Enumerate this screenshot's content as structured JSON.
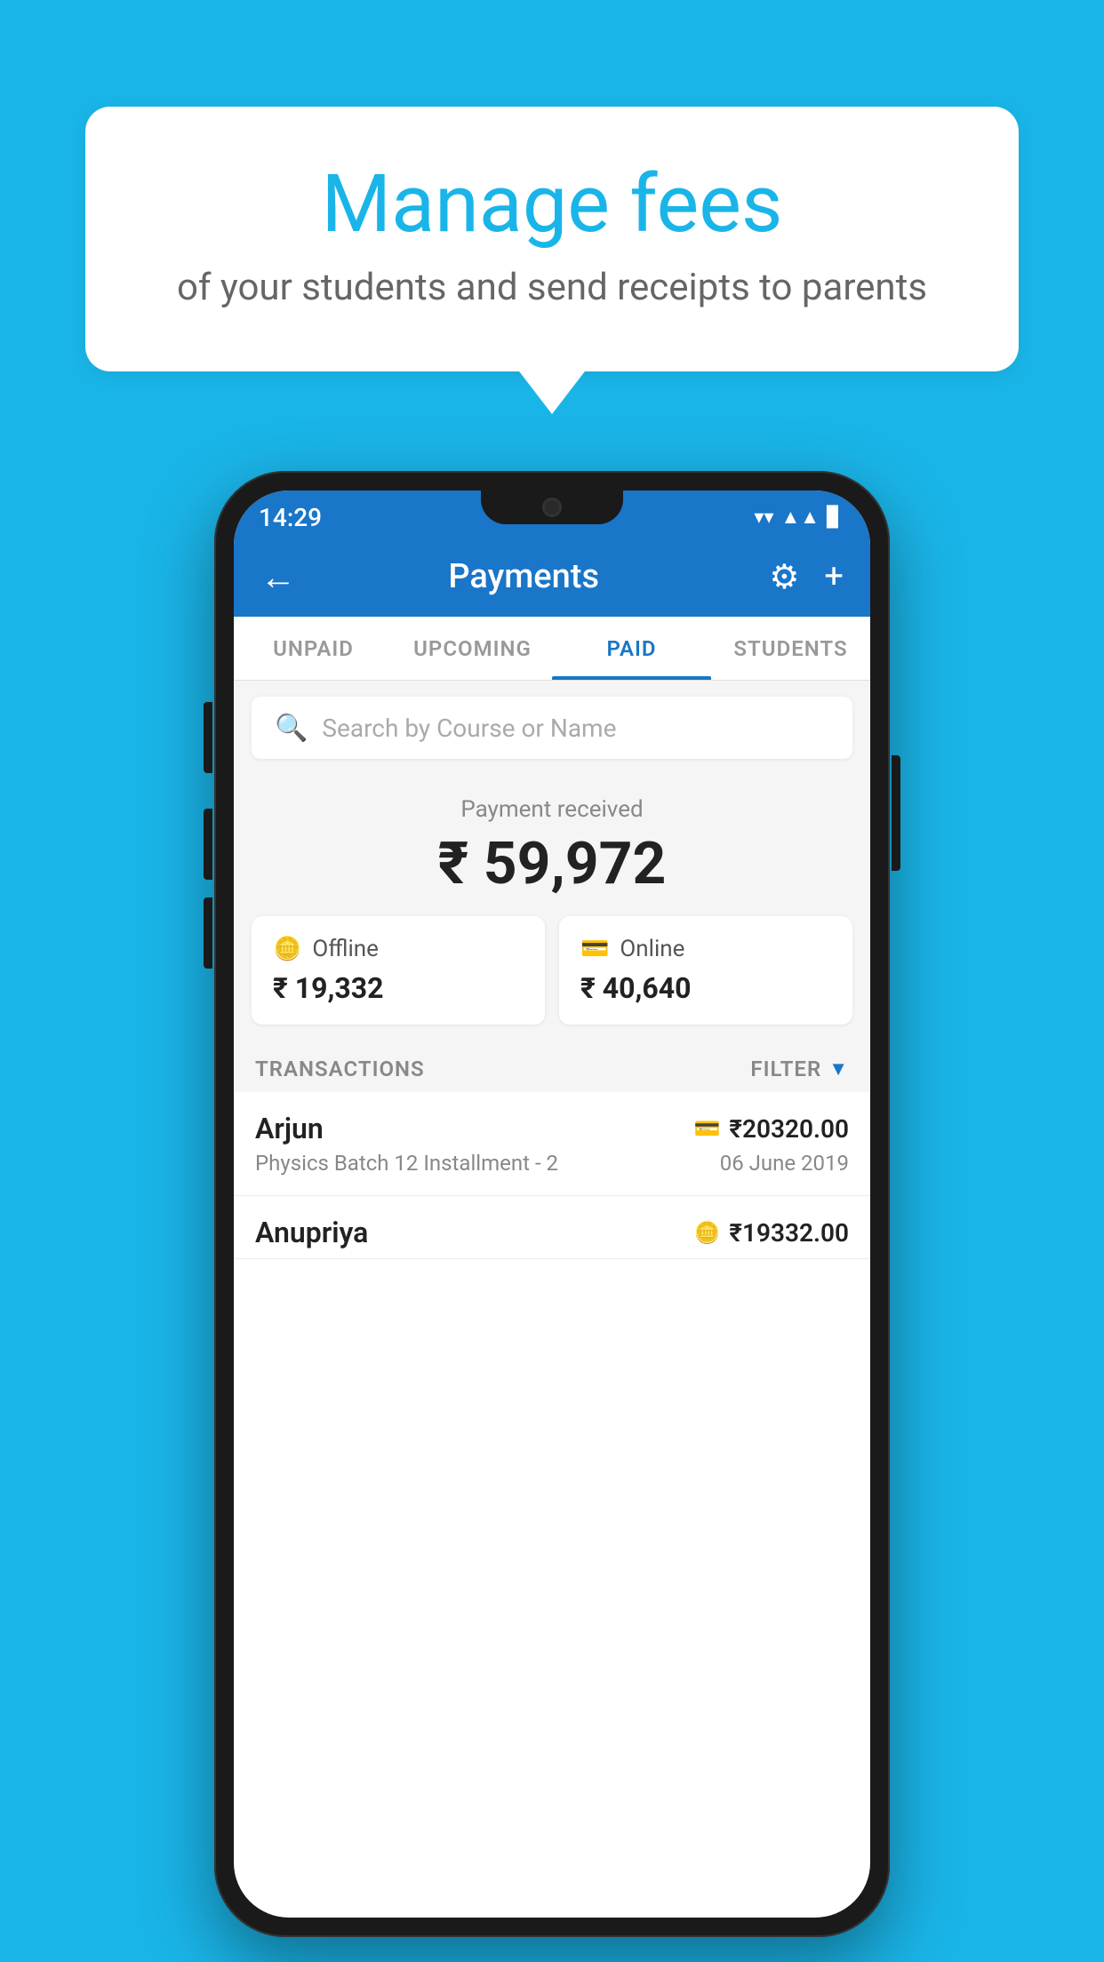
{
  "background_color": "#1ab5e8",
  "hero": {
    "title": "Manage fees",
    "subtitle": "of your students and send receipts to parents"
  },
  "status_bar": {
    "time": "14:29",
    "wifi": "▲",
    "signal": "▲",
    "battery": "▊"
  },
  "app_bar": {
    "title": "Payments",
    "back_icon": "←",
    "gear_icon": "⚙",
    "plus_icon": "+"
  },
  "tabs": [
    {
      "label": "UNPAID",
      "active": false
    },
    {
      "label": "UPCOMING",
      "active": false
    },
    {
      "label": "PAID",
      "active": true
    },
    {
      "label": "STUDENTS",
      "active": false
    }
  ],
  "search": {
    "placeholder": "Search by Course or Name"
  },
  "payment_received": {
    "label": "Payment received",
    "amount": "₹ 59,972",
    "offline": {
      "label": "Offline",
      "amount": "₹ 19,332"
    },
    "online": {
      "label": "Online",
      "amount": "₹ 40,640"
    }
  },
  "transactions_section": {
    "label": "TRANSACTIONS",
    "filter_label": "FILTER"
  },
  "transactions": [
    {
      "name": "Arjun",
      "amount": "₹20320.00",
      "course": "Physics Batch 12 Installment - 2",
      "date": "06 June 2019",
      "payment_mode": "online"
    },
    {
      "name": "Anupriya",
      "amount": "₹19332.00",
      "course": "",
      "date": "",
      "payment_mode": "offline"
    }
  ]
}
